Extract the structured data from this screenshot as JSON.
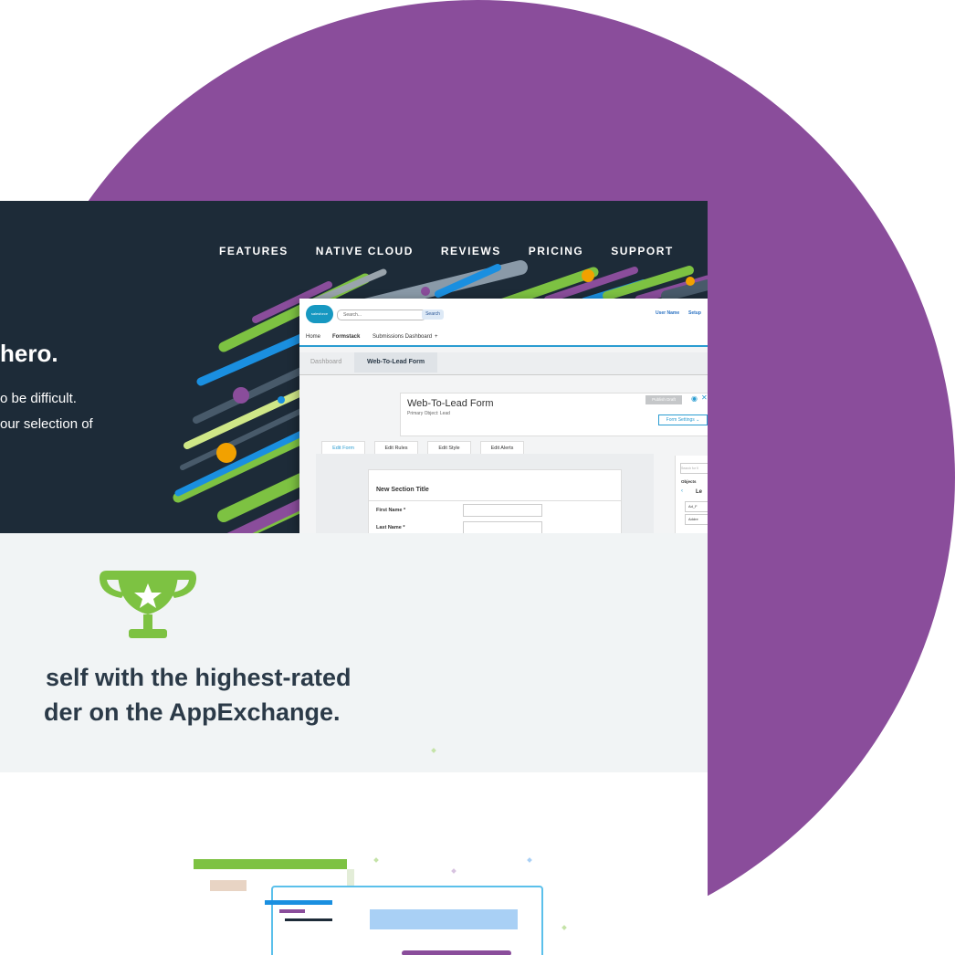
{
  "nav": {
    "items": [
      "FEATURES",
      "NATIVE CLOUD",
      "REVIEWS",
      "PRICING",
      "SUPPORT"
    ]
  },
  "hero": {
    "title": "hero.",
    "subtitle_line1": "o be difficult.",
    "subtitle_line2": "our selection of"
  },
  "app": {
    "logo_text": "salesforce",
    "search_placeholder": "Search...",
    "search_button": "Search",
    "user_name": "User Name",
    "setup": "Setup",
    "tabs": [
      "Home",
      "Formstack",
      "Submissions Dashboard",
      "+"
    ],
    "breadcrumb": [
      "Dashboard",
      "Web-To-Lead Form"
    ],
    "form_title": "Web-To-Lead Form",
    "form_object": "Primary Object: Lead",
    "publish_button": "Publish Draft",
    "settings_button": "Form Settings",
    "edit_tabs": [
      "Edit Form",
      "Edit Rules",
      "Edit Style",
      "Edit Alerts"
    ],
    "section_title": "New Section Title",
    "fields": [
      "First Name  *",
      "Last Name  *"
    ],
    "right_panel": {
      "search_placeholder": "Search for fi",
      "heading": "Objects",
      "object": "Le",
      "items": [
        "Ad_F",
        "Addre"
      ]
    }
  },
  "claim": {
    "line1": "self with the highest-rated",
    "line2": "der on the AppExchange."
  },
  "colors": {
    "disc": "#8a4d9b",
    "dark_band": "#1d2b38",
    "accent_green": "#7dc242",
    "accent_blue": "#1a8fe0",
    "accent_purple": "#8a4d9b",
    "accent_orange": "#f2a100"
  },
  "icons": [
    "trophy-icon",
    "star-icon",
    "eye-icon",
    "close-icon",
    "chevron-down-icon",
    "chevron-left-icon"
  ]
}
